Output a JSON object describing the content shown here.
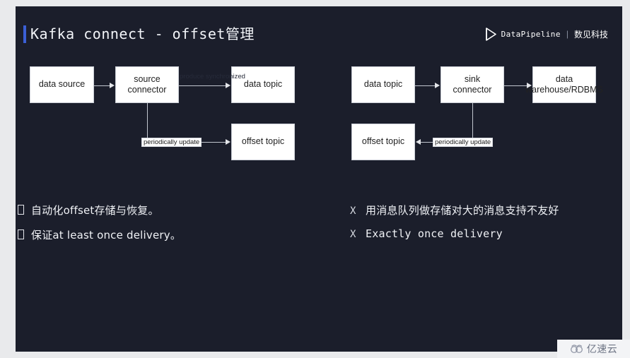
{
  "slide": {
    "title": "Kafka connect - offset管理",
    "accent_color": "#3b5fd6",
    "background_color": "#1b1e2b"
  },
  "brand": {
    "mark_icon": "play-outline-icon",
    "name": "DataPipeline",
    "separator": "|",
    "name_cn": "数见科技"
  },
  "diagram": {
    "left_flow": {
      "nodes": [
        {
          "id": "data-source",
          "label": "data source"
        },
        {
          "id": "source-connector",
          "label": "source connector"
        },
        {
          "id": "data-topic",
          "label": "data topic"
        },
        {
          "id": "offset-topic",
          "label": "offset topic"
        }
      ],
      "labels": {
        "produce": "produce synchronized",
        "periodic": "periodically update"
      }
    },
    "right_flow": {
      "nodes": [
        {
          "id": "data-topic-2",
          "label": "data topic"
        },
        {
          "id": "sink-connector",
          "label": "sink connector"
        },
        {
          "id": "data-warehouse",
          "label": "data warehouse/RDBMS"
        },
        {
          "id": "offset-topic-2",
          "label": "offset topic"
        }
      ],
      "labels": {
        "periodic": "periodically update"
      }
    }
  },
  "bullets": {
    "left": [
      {
        "marker": "tofu",
        "text": "自动化offset存储与恢复。"
      },
      {
        "marker": "tofu",
        "text": "保证at least once delivery。"
      }
    ],
    "right": [
      {
        "marker": "X",
        "text": "用消息队列做存储对大的消息支持不友好"
      },
      {
        "marker": "X",
        "text": "Exactly once delivery"
      }
    ]
  },
  "watermark": {
    "icon": "cloud-icon",
    "text": "亿速云"
  }
}
